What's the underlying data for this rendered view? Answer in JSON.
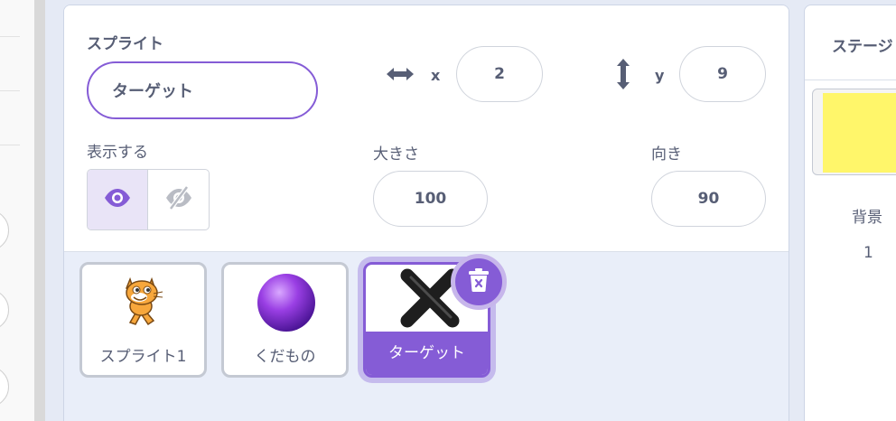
{
  "sprite_info": {
    "heading": "スプライト",
    "name_value": "ターゲット",
    "x_label": "x",
    "x_value": "2",
    "y_label": "y",
    "y_value": "9",
    "show_label": "表示する",
    "show_state": "shown",
    "size_label": "大きさ",
    "size_value": "100",
    "direction_label": "向き",
    "direction_value": "90"
  },
  "sprites": [
    {
      "name": "スプライト1",
      "icon": "cat-costume-icon",
      "selected": false
    },
    {
      "name": "くだもの",
      "icon": "purple-ball-icon",
      "selected": false
    },
    {
      "name": "ターゲット",
      "icon": "x-mark-icon",
      "selected": true
    }
  ],
  "stage": {
    "title": "ステージ",
    "backdrop_label": "背景",
    "backdrop_count": "1",
    "backdrop_color": "#fff66a"
  },
  "colors": {
    "accent": "#855cd6",
    "text": "#575e75",
    "pane_bg": "#e9eef9"
  }
}
